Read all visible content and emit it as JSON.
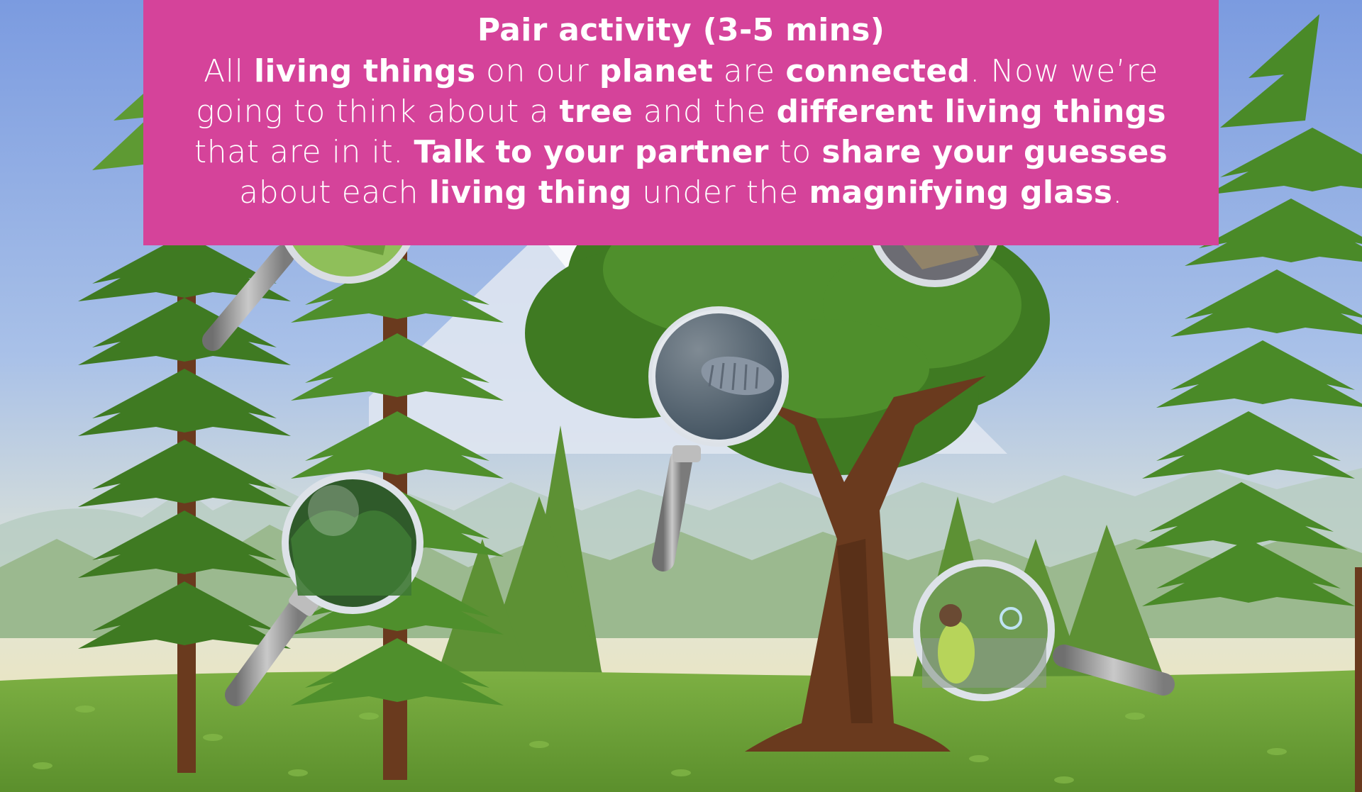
{
  "banner": {
    "title": "Pair activity (3-5 mins)",
    "lines": [
      [
        {
          "t": "All ",
          "b": false
        },
        {
          "t": "living things",
          "b": true
        },
        {
          "t": " on our ",
          "b": false
        },
        {
          "t": "planet",
          "b": true
        },
        {
          "t": " are ",
          "b": false
        },
        {
          "t": "connected",
          "b": true
        },
        {
          "t": ". Now we’re",
          "b": false
        }
      ],
      [
        {
          "t": "going to think about a ",
          "b": false
        },
        {
          "t": "tree",
          "b": true
        },
        {
          "t": " and the ",
          "b": false
        },
        {
          "t": "different living things",
          "b": true
        }
      ],
      [
        {
          "t": "that are in it. ",
          "b": false
        },
        {
          "t": "Talk to your partner",
          "b": true
        },
        {
          "t": " to ",
          "b": false
        },
        {
          "t": "share your guesses",
          "b": true
        }
      ],
      [
        {
          "t": "about each ",
          "b": false
        },
        {
          "t": "living thing",
          "b": true
        },
        {
          "t": " under the ",
          "b": false
        },
        {
          "t": "magnifying glass",
          "b": true
        },
        {
          "t": ".",
          "b": false
        }
      ]
    ]
  },
  "colors": {
    "banner": "#d5439a",
    "sky_top": "#7d9ee0",
    "grass": "#6fa13a",
    "pine": "#3f7a22",
    "trunk": "#6a3a1e"
  },
  "magnifiers": [
    {
      "id": "magnifier-moss",
      "icon": "moss-closeup"
    },
    {
      "id": "magnifier-bark",
      "icon": "bark-closeup"
    },
    {
      "id": "magnifier-woodlouse",
      "icon": "woodlouse-closeup"
    },
    {
      "id": "magnifier-forest-canopy",
      "icon": "forest-canopy-closeup"
    },
    {
      "id": "magnifier-child",
      "icon": "child-with-bubble-closeup"
    }
  ]
}
